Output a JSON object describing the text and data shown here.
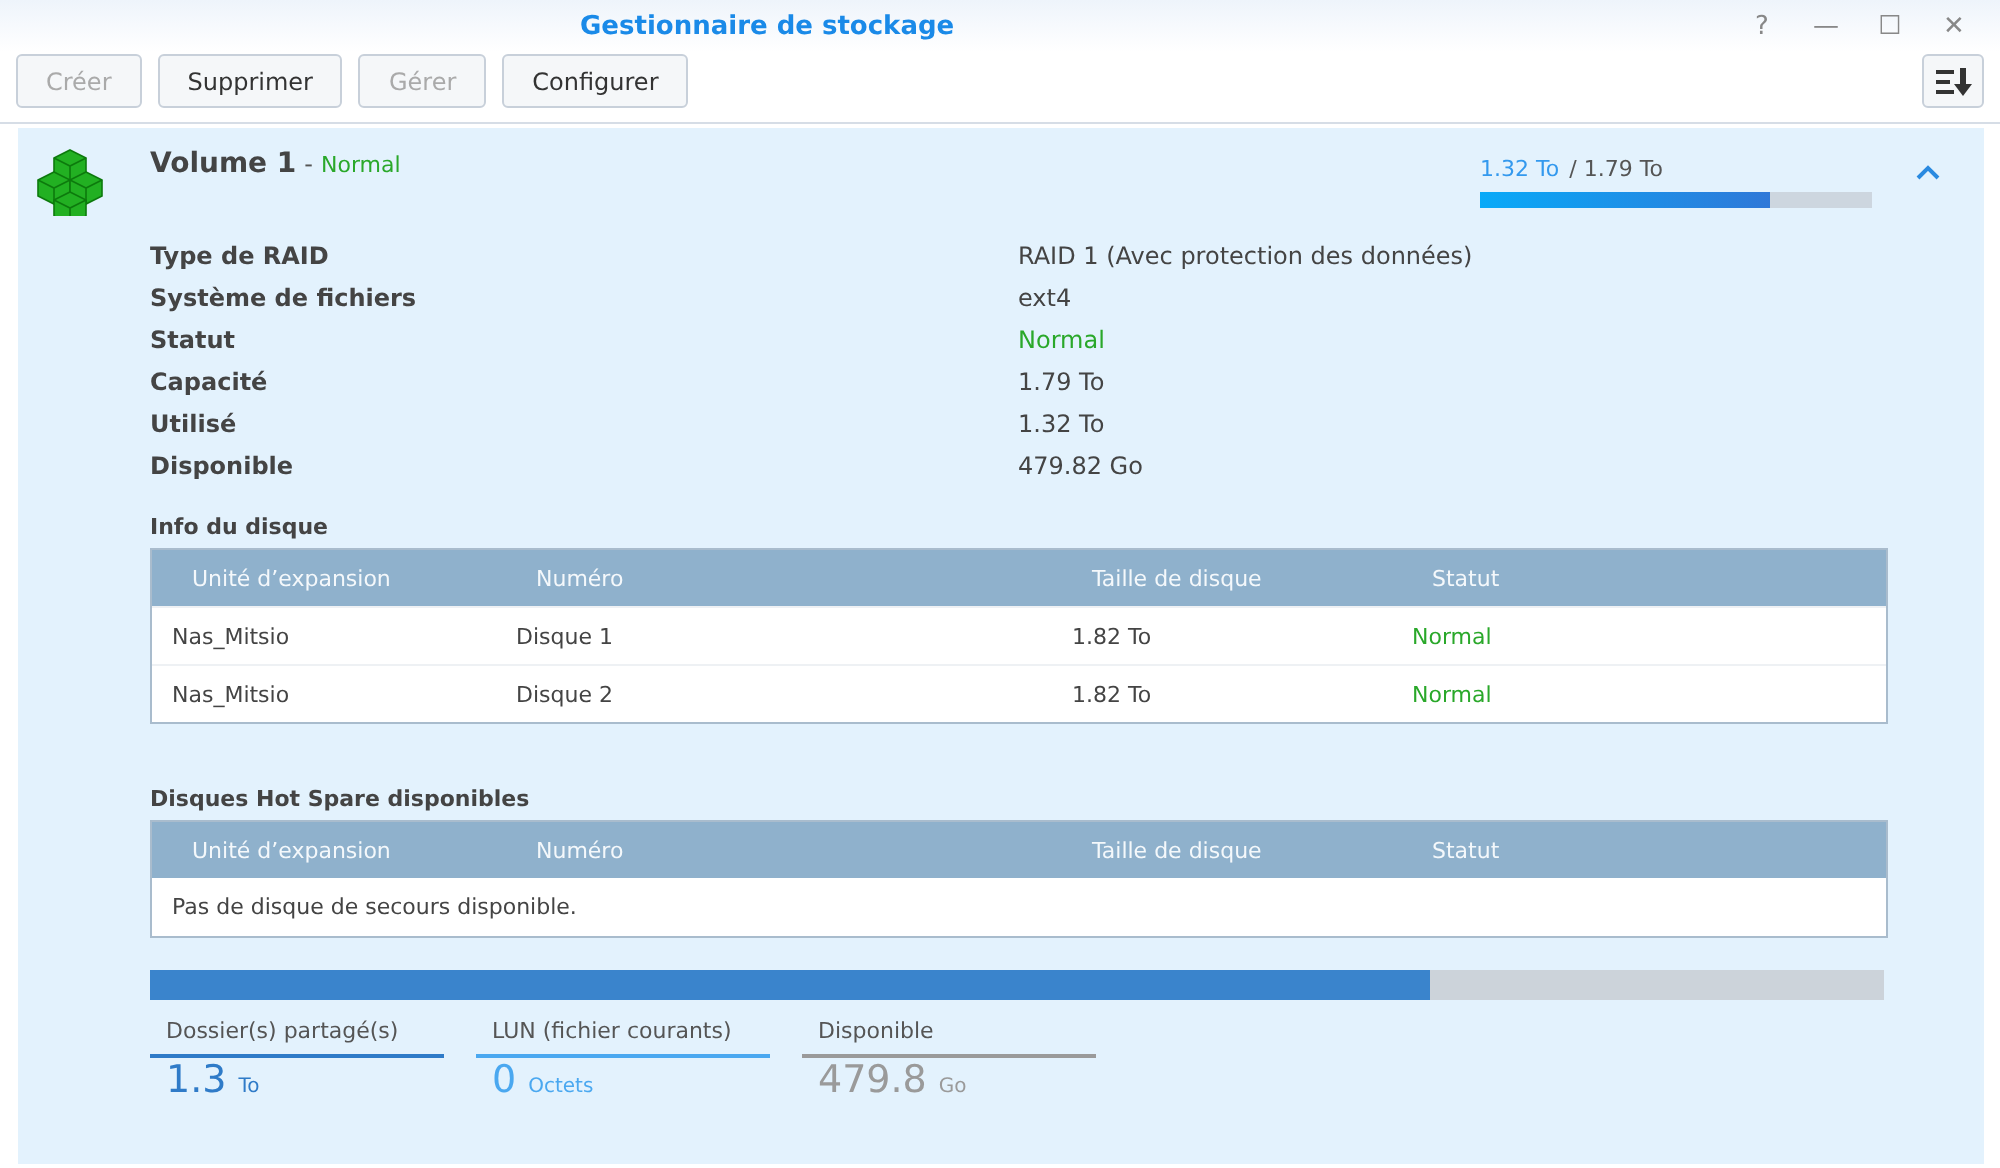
{
  "window": {
    "title": "Gestionnaire de stockage",
    "controls": [
      "?",
      "—",
      "☐",
      "✕"
    ]
  },
  "toolbar": {
    "buttons": [
      {
        "label": "Créer",
        "disabled": true
      },
      {
        "label": "Supprimer",
        "disabled": false
      },
      {
        "label": "Gérer",
        "disabled": true
      },
      {
        "label": "Configurer",
        "disabled": false
      }
    ]
  },
  "volume": {
    "name": "Volume 1",
    "separator": "-",
    "status": "Normal",
    "expanded": true,
    "used": "1.32 To",
    "slash": "/",
    "total": "1.79 To",
    "level": 0.74,
    "details": [
      {
        "label": "Type de RAID",
        "value": "RAID 1 (Avec protection des données)",
        "kind": "plain"
      },
      {
        "label": "Système de fichiers",
        "value": "ext4",
        "kind": "plain"
      },
      {
        "label": "Statut",
        "value": "Normal",
        "kind": "status"
      },
      {
        "label": "Capacité",
        "value": "1.79 To",
        "kind": "plain"
      },
      {
        "label": "Utilisé",
        "value": "1.32 To",
        "kind": "plain"
      },
      {
        "label": "Disponible",
        "value": "479.82 Go",
        "kind": "plain"
      }
    ],
    "disk_info": {
      "title": "Info du disque",
      "columns": [
        "Unité d’expansion",
        "Numéro",
        "Taille de disque",
        "Statut"
      ],
      "rows": [
        [
          "Nas_Mitsio",
          "Disque 1",
          "1.82 To",
          "Normal"
        ],
        [
          "Nas_Mitsio",
          "Disque 2",
          "1.82 To",
          "Normal"
        ]
      ]
    },
    "hot_spare": {
      "title": "Disques Hot Spare disponibles",
      "columns": [
        "Unité d’expansion",
        "Numéro",
        "Taille de disque",
        "Statut"
      ],
      "empty_message": "Pas de disque de secours disponible."
    },
    "usage": {
      "level": 0.738,
      "legend": [
        {
          "label": "Dossier(s) partagé(s)",
          "value": "1.3",
          "unit": "To",
          "color": "#2f7bc8"
        },
        {
          "label": "LUN (fichier courants)",
          "value": "0",
          "unit": "Octets",
          "color": "#4aa8f0"
        },
        {
          "label": "Disponible",
          "value": "479.8",
          "unit": "Go",
          "color": "#9a9a9a"
        }
      ]
    }
  }
}
